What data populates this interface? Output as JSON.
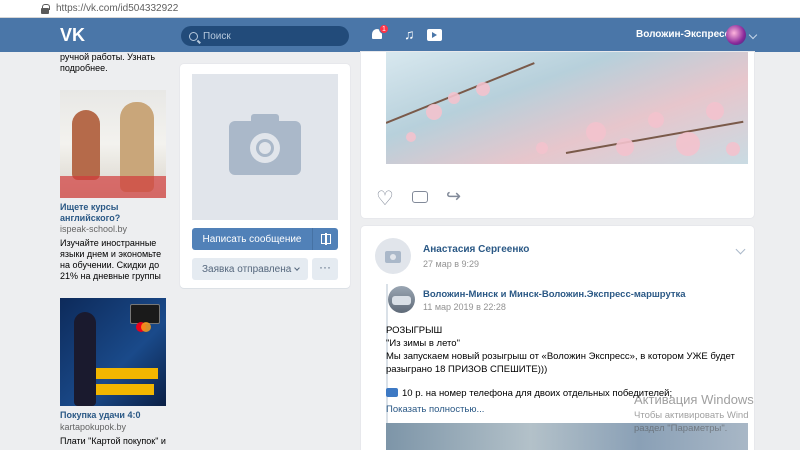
{
  "browser": {
    "url": "https://vk.com/id504332922"
  },
  "header": {
    "logo": "VK",
    "search_placeholder": "Поиск",
    "notifications_count": "1",
    "user_name": "Воложин-Экспресс"
  },
  "ads": {
    "prev_text_1": "ручной работы. Узнать",
    "prev_text_2": "подробнее.",
    "ad1": {
      "title_1": "Ищете курсы",
      "title_2": "английского?",
      "host": "ispeak-school.by",
      "desc": [
        "Изучайте иностранные",
        "языки днем и экономьте",
        "на обучении. Скидки до",
        "21% на дневные группы"
      ]
    },
    "ad2": {
      "title": "Покупка удачи 4:0",
      "host": "kartapokupok.by",
      "desc": [
        "Плати \"Картой покупок\" и"
      ]
    }
  },
  "profile": {
    "write_message": "Написать сообщение",
    "request_sent": "Заявка отправлена",
    "more": "···"
  },
  "post2": {
    "author": "Анастасия Сергеенко",
    "date": "27 мар в 9:29",
    "repost_author": "Воложин-Минск и Минск-Воложин.Экспресс-маршрутка",
    "repost_date": "11 мар 2019 в 22:28",
    "text_lines": [
      "РОЗЫГРЫШ",
      "\"Из зимы в лето\"",
      "Мы запускаем новый розыгрыш от «Воложин Экспресс», в котором УЖЕ будет",
      "разыграно 18 ПРИЗОВ СПЕШИТЕ)))"
    ],
    "phone_line": "10 р. на номер телефона для двоих отдельных победителей;",
    "show_more": "Показать полностью..."
  },
  "watermark": {
    "line1": "Активация Windows",
    "line2": "Чтобы активировать Wind",
    "line3": "раздел \"Параметры\"."
  },
  "colors": {
    "vk_blue": "#4a76a8",
    "link": "#2a5885",
    "button": "#5181b8",
    "background": "#edeef0"
  }
}
